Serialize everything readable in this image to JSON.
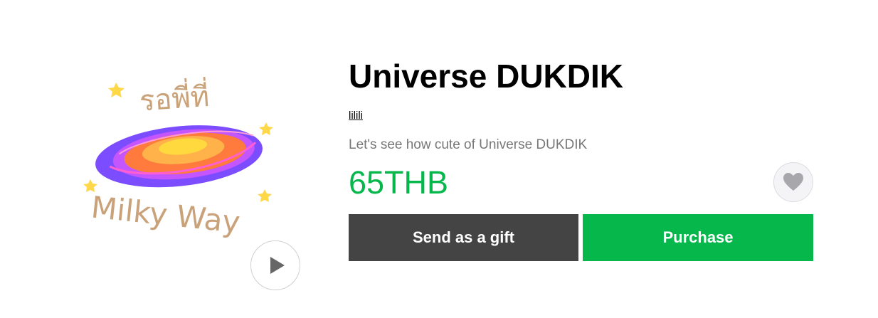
{
  "product": {
    "title": "Universe DUKDIK",
    "author": "lilili",
    "description": "Let's see how cute of Universe DUKDIK",
    "price": "65THB"
  },
  "sticker": {
    "text_top": "รอพี่ที่",
    "text_bottom": "Milky Way",
    "icon": "galaxy-sticker",
    "colors": {
      "outer": "#7b4dff",
      "ring": "#c455ff",
      "middle": "#ff7a3d",
      "core": "#ffd93d",
      "stars": "#ffd84a",
      "lettering": "#c9a27a"
    }
  },
  "actions": {
    "play_icon": "play-icon",
    "favorite_icon": "heart-icon",
    "gift_label": "Send as a gift",
    "purchase_label": "Purchase"
  },
  "colors": {
    "price": "#06b74c",
    "purchase": "#06b74c",
    "gift": "#444444"
  }
}
